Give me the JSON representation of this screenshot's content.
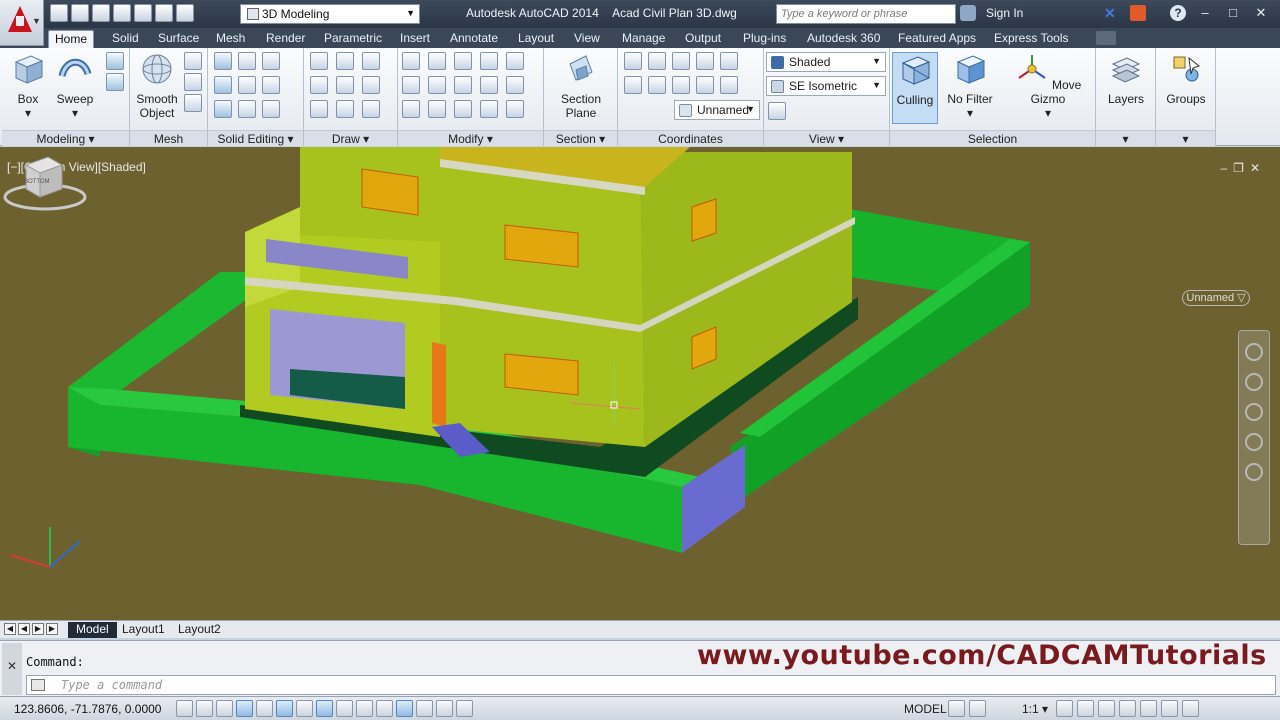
{
  "titlebar": {
    "workspace": "3D Modeling",
    "app_title": "Autodesk AutoCAD 2014",
    "file_title": "Acad Civil Plan 3D.dwg",
    "search_placeholder": "Type a keyword or phrase",
    "sign_in": "Sign In",
    "help_label": "?"
  },
  "tabs": [
    "Home",
    "Solid",
    "Surface",
    "Mesh",
    "Render",
    "Parametric",
    "Insert",
    "Annotate",
    "Layout",
    "View",
    "Manage",
    "Output",
    "Plug-ins",
    "Autodesk 360",
    "Featured Apps",
    "Express Tools"
  ],
  "ribbon": {
    "modeling": {
      "title": "Modeling ▾",
      "box": "Box",
      "sweep": "Sweep"
    },
    "mesh": {
      "title": "Mesh",
      "smooth_object": "Smooth Object"
    },
    "solid_editing": {
      "title": "Solid Editing ▾"
    },
    "draw": {
      "title": "Draw ▾"
    },
    "modify": {
      "title": "Modify ▾"
    },
    "section": {
      "title": "Section ▾",
      "section_plane": "Section Plane"
    },
    "coordinates": {
      "title": "Coordinates",
      "ucs_name": "Unnamed"
    },
    "view": {
      "title": "View ▾",
      "visual_style": "Shaded",
      "view_direction": "SE Isometric"
    },
    "selection": {
      "title": "Selection",
      "culling": "Culling",
      "no_filter": "No Filter",
      "move_gizmo": "Move Gizmo"
    },
    "layers": {
      "label": "Layers"
    },
    "groups": {
      "label": "Groups"
    }
  },
  "viewport": {
    "label": "[−][Custom View][Shaded]",
    "viewcube_face": "BOTTOM",
    "named_view": "Unnamed ▽"
  },
  "layout_tabs": [
    "Model",
    "Layout1",
    "Layout2"
  ],
  "command": {
    "history": "Command:",
    "placeholder": "Type a command"
  },
  "watermark": "www.youtube.com/CADCAMTutorials",
  "statusbar": {
    "coordinates": "123.8606, -71.7876, 0.0000",
    "model": "MODEL",
    "scale": "1:1 ▾"
  },
  "colors": {
    "viewport_bg": "#6d6130",
    "wall_green": "#18b52e",
    "building_yellow_green": "#a8c21d",
    "window_orange": "#e2a70d",
    "title_bar": "#2b3646"
  }
}
